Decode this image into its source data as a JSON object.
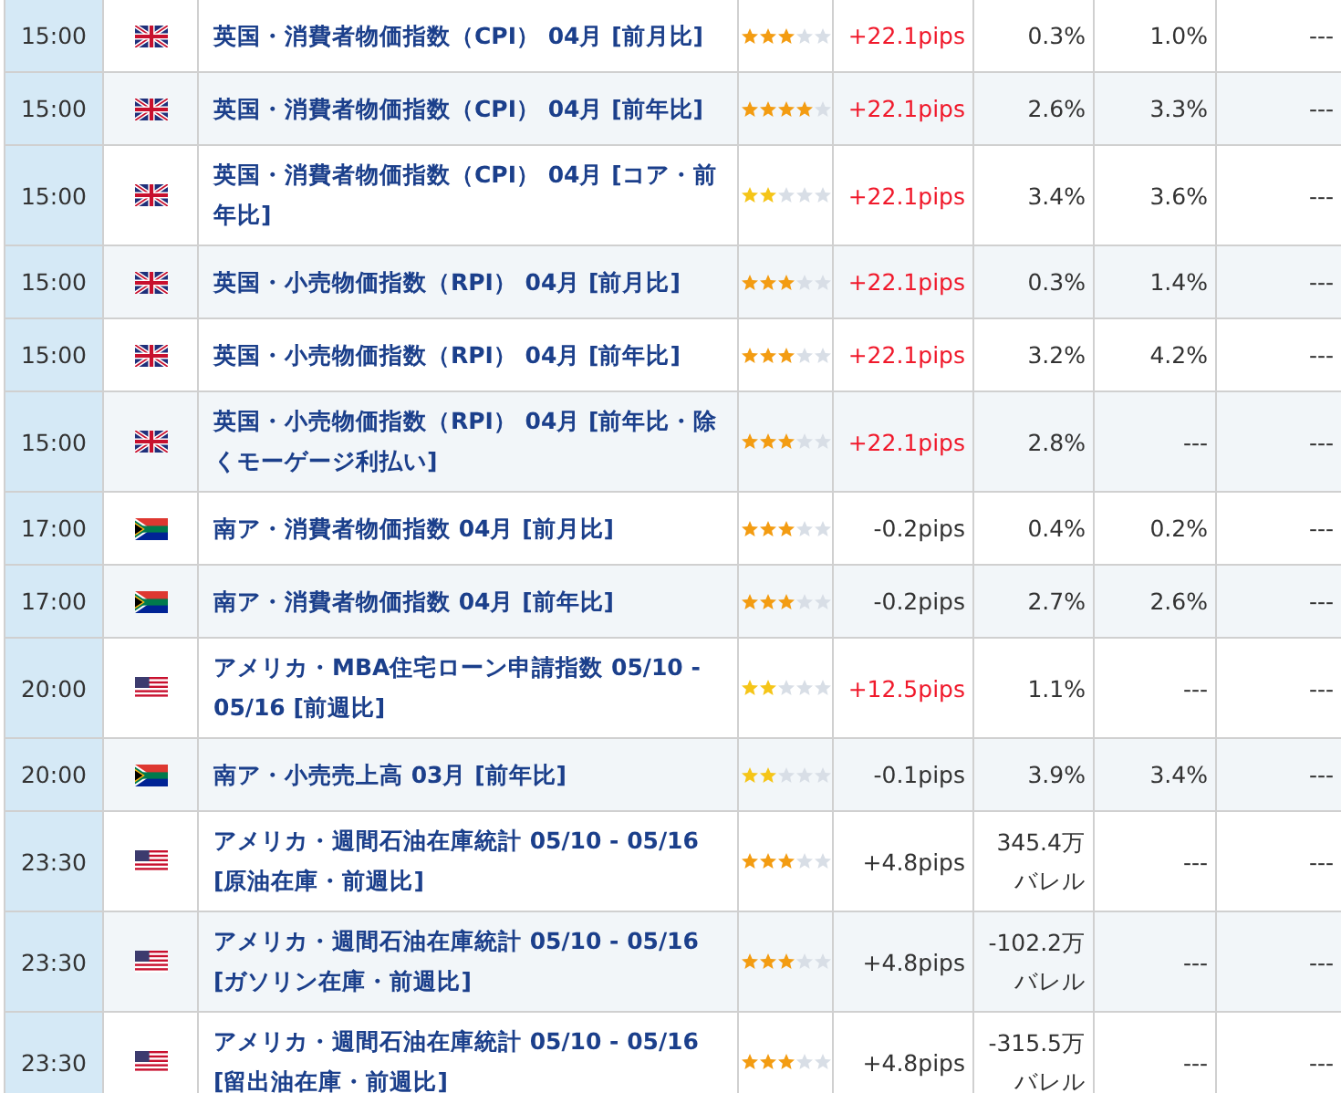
{
  "rows": [
    {
      "time": "15:00",
      "kind": "uk",
      "title": "英国・消費者物価指数（CPI） 04月 [前月比]",
      "stars": 3,
      "pips": "+22.1pips",
      "highlighted": true,
      "column_6": "0.3%",
      "column_7": "1.0%",
      "column_8": "---"
    },
    {
      "time": "15:00",
      "kind": "uk",
      "title": "英国・消費者物価指数（CPI） 04月 [前年比]",
      "stars": 4,
      "pips": "+22.1pips",
      "highlighted": true,
      "column_6": "2.6%",
      "column_7": "3.3%",
      "column_8": "---"
    },
    {
      "time": "15:00",
      "kind": "uk",
      "title": "英国・消費者物価指数（CPI） 04月 [コア・前年比]",
      "stars": 2,
      "pips": "+22.1pips",
      "highlighted": true,
      "column_6": "3.4%",
      "column_7": "3.6%",
      "column_8": "---"
    },
    {
      "time": "15:00",
      "kind": "uk",
      "title": "英国・小売物価指数（RPI） 04月 [前月比]",
      "stars": 3,
      "pips": "+22.1pips",
      "highlighted": true,
      "column_6": "0.3%",
      "column_7": "1.4%",
      "column_8": "---"
    },
    {
      "time": "15:00",
      "kind": "uk",
      "title": "英国・小売物価指数（RPI） 04月 [前年比]",
      "stars": 3,
      "pips": "+22.1pips",
      "highlighted": true,
      "column_6": "3.2%",
      "column_7": "4.2%",
      "column_8": "---"
    },
    {
      "time": "15:00",
      "kind": "uk",
      "title": "英国・小売物価指数（RPI） 04月 [前年比・除くモーゲージ利払い]",
      "stars": 3,
      "pips": "+22.1pips",
      "highlighted": true,
      "column_6": "2.8%",
      "column_7": "---",
      "column_8": "---"
    },
    {
      "time": "17:00",
      "kind": "za",
      "title": "南ア・消費者物価指数 04月 [前月比]",
      "stars": 3,
      "pips": "-0.2pips",
      "highlighted": false,
      "column_6": "0.4%",
      "column_7": "0.2%",
      "column_8": "---"
    },
    {
      "time": "17:00",
      "kind": "za",
      "title": "南ア・消費者物価指数 04月 [前年比]",
      "stars": 3,
      "pips": "-0.2pips",
      "highlighted": false,
      "column_6": "2.7%",
      "column_7": "2.6%",
      "column_8": "---"
    },
    {
      "time": "20:00",
      "kind": "us",
      "title": "アメリカ・MBA住宅ローン申請指数 05/10 - 05/16 [前週比]",
      "stars": 2,
      "pips": "+12.5pips",
      "highlighted": true,
      "column_6": "1.1%",
      "column_7": "---",
      "column_8": "---"
    },
    {
      "time": "20:00",
      "kind": "za",
      "title": "南ア・小売売上高 03月 [前年比]",
      "stars": 2,
      "pips": "-0.1pips",
      "highlighted": false,
      "column_6": "3.9%",
      "column_7": "3.4%",
      "column_8": "---"
    },
    {
      "time": "23:30",
      "kind": "us",
      "title": "アメリカ・週間石油在庫統計 05/10 - 05/16 [原油在庫・前週比]",
      "stars": 3,
      "pips": "+4.8pips",
      "highlighted": false,
      "column_6": "345.4万バレル",
      "column_7": "---",
      "column_8": "---"
    },
    {
      "time": "23:30",
      "kind": "us",
      "title": "アメリカ・週間石油在庫統計 05/10 - 05/16 [ガソリン在庫・前週比]",
      "stars": 3,
      "pips": "+4.8pips",
      "highlighted": false,
      "column_6": "-102.2万バレル",
      "column_7": "---",
      "column_8": "---"
    },
    {
      "time": "23:30",
      "kind": "us",
      "title": "アメリカ・週間石油在庫統計 05/10 - 05/16 [留出油在庫・前週比]",
      "stars": 3,
      "pips": "+4.8pips",
      "highlighted": false,
      "column_6": "-315.5万バレル",
      "column_7": "---",
      "column_8": "---"
    }
  ]
}
